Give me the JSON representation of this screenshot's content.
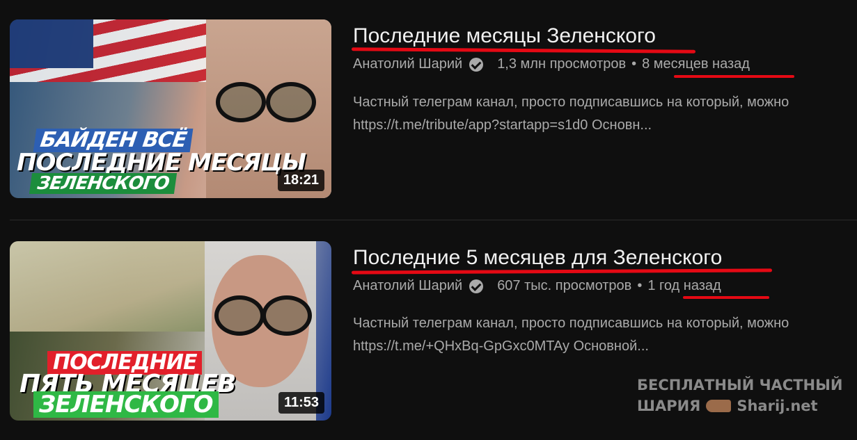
{
  "videos": [
    {
      "title": "Последние месяцы Зеленского",
      "channel": "Анатолий Шарий",
      "views": "1,3 млн просмотров",
      "separator": "•",
      "age": "8 месяцев назад",
      "description_line1": "Частный телеграм канал, просто подписавшись на который, можно",
      "description_line2": "https://t.me/tribute/app?startapp=s1d0 Основн...",
      "duration": "18:21",
      "thumb_text": [
        "БАЙДЕН ВСЁ",
        "ПОСЛЕДНИЕ МЕСЯЦЫ",
        "ЗЕЛЕНСКОГО"
      ]
    },
    {
      "title": "Последние 5 месяцев для Зеленского",
      "channel": "Анатолий Шарий",
      "views": "607 тыс. просмотров",
      "separator": "•",
      "age": "1 год назад",
      "description_line1": "Частный телеграм канал, просто подписавшись на который, можно",
      "description_line2": "https://t.me/+QHxBq-GpGxc0MTAy Основной...",
      "duration": "11:53",
      "thumb_text": [
        "ПОСЛЕДНИЕ",
        "ПЯТЬ МЕСЯЦЕВ",
        "ЗЕЛЕНСКОГО"
      ]
    }
  ],
  "watermark": {
    "line1": "БЕСПЛАТНЫЙ ЧАСТНЫЙ",
    "line2_left": "ШАРИЯ",
    "icon": "pointing-hand-icon",
    "line2_right": "Sharij.net"
  },
  "colors": {
    "background": "#0f0f0f",
    "title": "#f1f1f1",
    "secondary_text": "#aaaaaa",
    "highlight_underline": "#e50914"
  }
}
